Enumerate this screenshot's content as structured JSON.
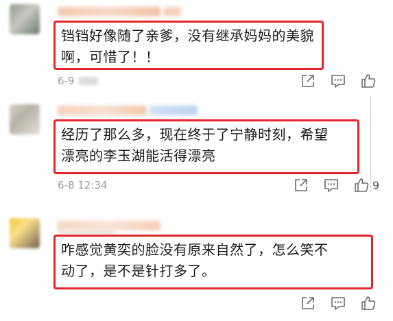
{
  "comments": [
    {
      "text_line1": "铛铛好像随了亲爹，没有继承妈妈的美貌",
      "text_line2": "啊，可惜了！！",
      "timestamp": "6-9",
      "like_count": ""
    },
    {
      "text_line1": "经历了那么多，现在终于了宁静时刻，希望",
      "text_line2": "漂亮的李玉湖能活得漂亮",
      "timestamp": "6-8 12:34",
      "like_count": "9"
    },
    {
      "text_line1": "咋感觉黄奕的脸没有原来自然了，怎么笑不",
      "text_line2": "动了，是不是针打多了。",
      "timestamp": "",
      "like_count": ""
    }
  ],
  "icons": {
    "share": "share-icon",
    "comment": "comment-icon",
    "like": "like-icon"
  },
  "colors": {
    "highlight_border": "#e3242b",
    "timestamp": "#9a9a9a",
    "icon": "#6b6b6b"
  }
}
